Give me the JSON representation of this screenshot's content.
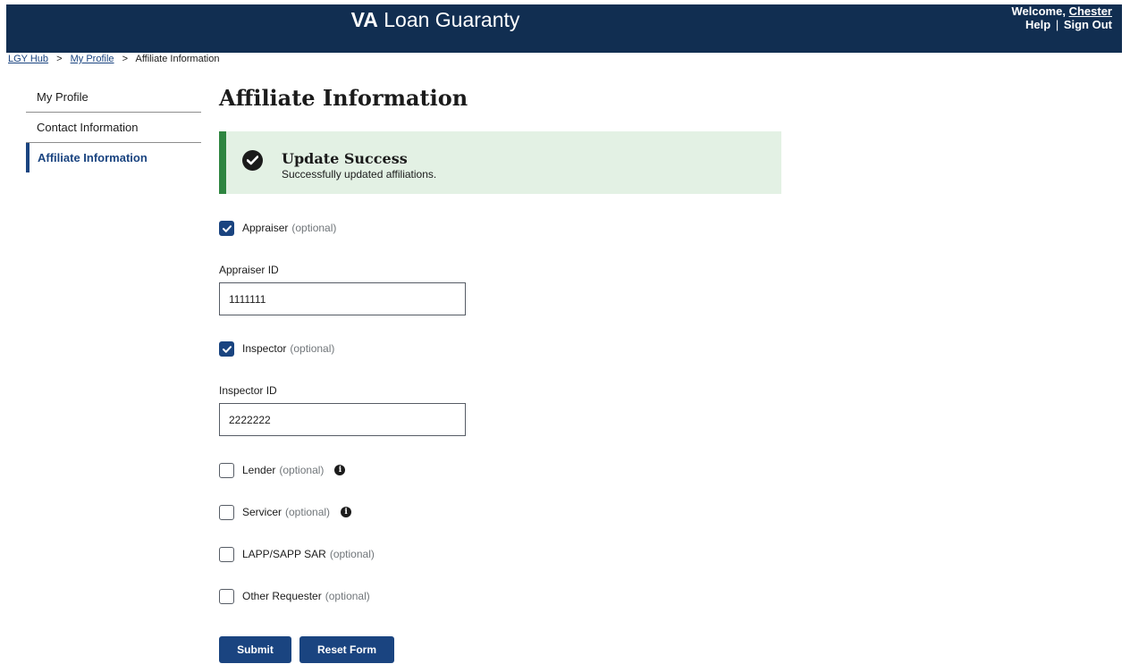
{
  "header": {
    "brand_bold": "VA",
    "brand_rest": "Loan Guaranty",
    "welcome_prefix": "Welcome,",
    "user_name": "Chester",
    "help_label": "Help",
    "separator": "|",
    "signout_label": "Sign Out"
  },
  "breadcrumb": {
    "items": [
      "LGY Hub",
      "My Profile",
      "Affiliate Information"
    ],
    "separator": ">"
  },
  "sidebar": {
    "items": [
      {
        "label": "My Profile",
        "active": false
      },
      {
        "label": "Contact Information",
        "active": false
      },
      {
        "label": "Affiliate Information",
        "active": true
      }
    ]
  },
  "page": {
    "title": "Affiliate Information"
  },
  "alert": {
    "type": "success",
    "heading": "Update Success",
    "body": "Successfully updated affiliations."
  },
  "form": {
    "affiliations": [
      {
        "label": "Appraiser",
        "optional": "(optional)",
        "checked": true,
        "info": false,
        "id_label": "Appraiser ID",
        "id_value": "1111111"
      },
      {
        "label": "Inspector",
        "optional": "(optional)",
        "checked": true,
        "info": false,
        "id_label": "Inspector ID",
        "id_value": "2222222"
      },
      {
        "label": "Lender",
        "optional": "(optional)",
        "checked": false,
        "info": true
      },
      {
        "label": "Servicer",
        "optional": "(optional)",
        "checked": false,
        "info": true
      },
      {
        "label": "LAPP/SAPP SAR",
        "optional": "(optional)",
        "checked": false,
        "info": false
      },
      {
        "label": "Other Requester",
        "optional": "(optional)",
        "checked": false,
        "info": false
      }
    ],
    "submit_label": "Submit",
    "reset_label": "Reset Form"
  },
  "colors": {
    "header_bg": "#112e51",
    "primary": "#1a4480",
    "success_border": "#2e8540",
    "success_bg": "#e3f1e4"
  },
  "icons": {
    "alert": "check-circle-icon",
    "checkbox_checked": "checkmark-icon",
    "info": "info-icon"
  }
}
